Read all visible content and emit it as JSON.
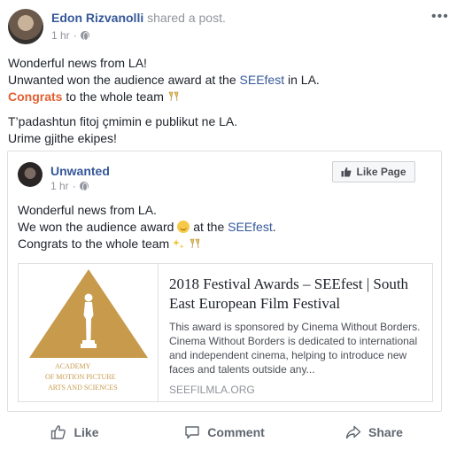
{
  "author": {
    "name": "Edon Rizvanolli",
    "shared_text": "shared a post."
  },
  "meta": {
    "time": "1 hr",
    "dot": "·"
  },
  "post": {
    "line1": "Wonderful news from LA!",
    "line2_pre": "Unwanted won the audience award at the ",
    "line2_link": "SEEfest",
    "line2_post": " in LA.",
    "line3_bold": "Congrats",
    "line3_post": " to the whole team",
    "line4": "T’padashtun fitoj çmimin e publikut ne LA.",
    "line5": "Urime gjithe ekipes!"
  },
  "shared": {
    "page_name": "Unwanted",
    "time": "1 hr",
    "dot": "·",
    "like_page_label": "Like Page",
    "line1": "Wonderful news from LA.",
    "line2_pre": "We won the audience award",
    "line2_mid": " at the ",
    "line2_link": "SEEfest",
    "line2_post": ".",
    "line3": "Congrats to the whole team"
  },
  "preview": {
    "logo_lines": [
      "ACADEMY",
      "OF MOTION PICTURE",
      "ARTS AND SCIENCES"
    ],
    "title": "2018 Festival Awards – SEEfest | South East European Film Festival",
    "description": "This award is sponsored by Cinema Without Borders. Cinema Without Borders is dedicated to international and independent cinema, helping to introduce new faces and talents outside any...",
    "domain": "SEEFILMLA.ORG"
  },
  "actions": {
    "like": "Like",
    "comment": "Comment",
    "share": "Share"
  },
  "colors": {
    "link": "#365899",
    "congrats": "#e06030",
    "muted": "#90949c",
    "gold": "#c89a4b"
  },
  "icons": [
    "globe-icon",
    "more-options-icon",
    "thumbs-up-icon",
    "comment-icon",
    "share-icon",
    "champagne-emoji-icon",
    "smile-emoji-icon",
    "sparkles-emoji-icon",
    "oscar-statuette-icon"
  ]
}
